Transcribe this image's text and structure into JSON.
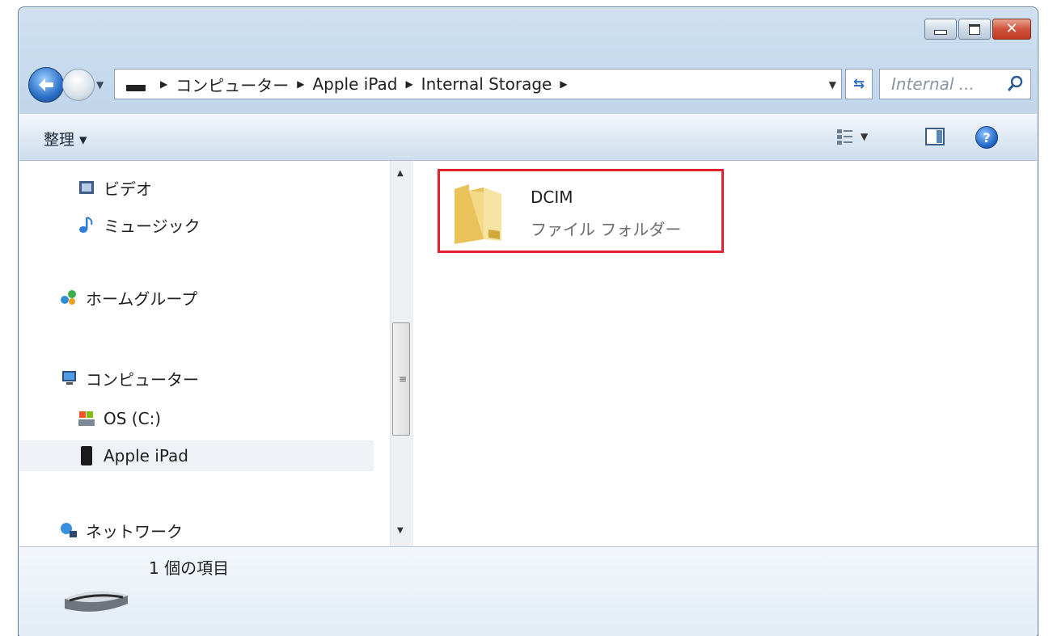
{
  "window": {
    "caption": {
      "minimize": "minimize",
      "maximize": "maximize",
      "close": "close"
    }
  },
  "address": {
    "crumbs": [
      "コンピューター",
      "Apple iPad",
      "Internal Storage"
    ],
    "search_placeholder": "Internal ..."
  },
  "toolbar": {
    "organize_label": "整理 ▾",
    "help_label": "?"
  },
  "navpane": {
    "items": [
      {
        "label": "ビデオ",
        "icon": "video-library-icon"
      },
      {
        "label": "ミュージック",
        "icon": "music-library-icon"
      },
      {
        "label": "ホームグループ",
        "icon": "homegroup-icon"
      },
      {
        "label": "コンピューター",
        "icon": "computer-icon"
      },
      {
        "label": "OS (C:)",
        "icon": "drive-icon"
      },
      {
        "label": "Apple iPad",
        "icon": "ipad-icon"
      },
      {
        "label": "ネットワーク",
        "icon": "network-icon"
      }
    ]
  },
  "content": {
    "items": [
      {
        "name": "DCIM",
        "type": "ファイル フォルダー",
        "highlight_color": "#e2222f"
      }
    ]
  },
  "details": {
    "count_text": "1 個の項目"
  },
  "colors": {
    "accent": "#2b6fc7",
    "highlight": "#e2222f"
  }
}
